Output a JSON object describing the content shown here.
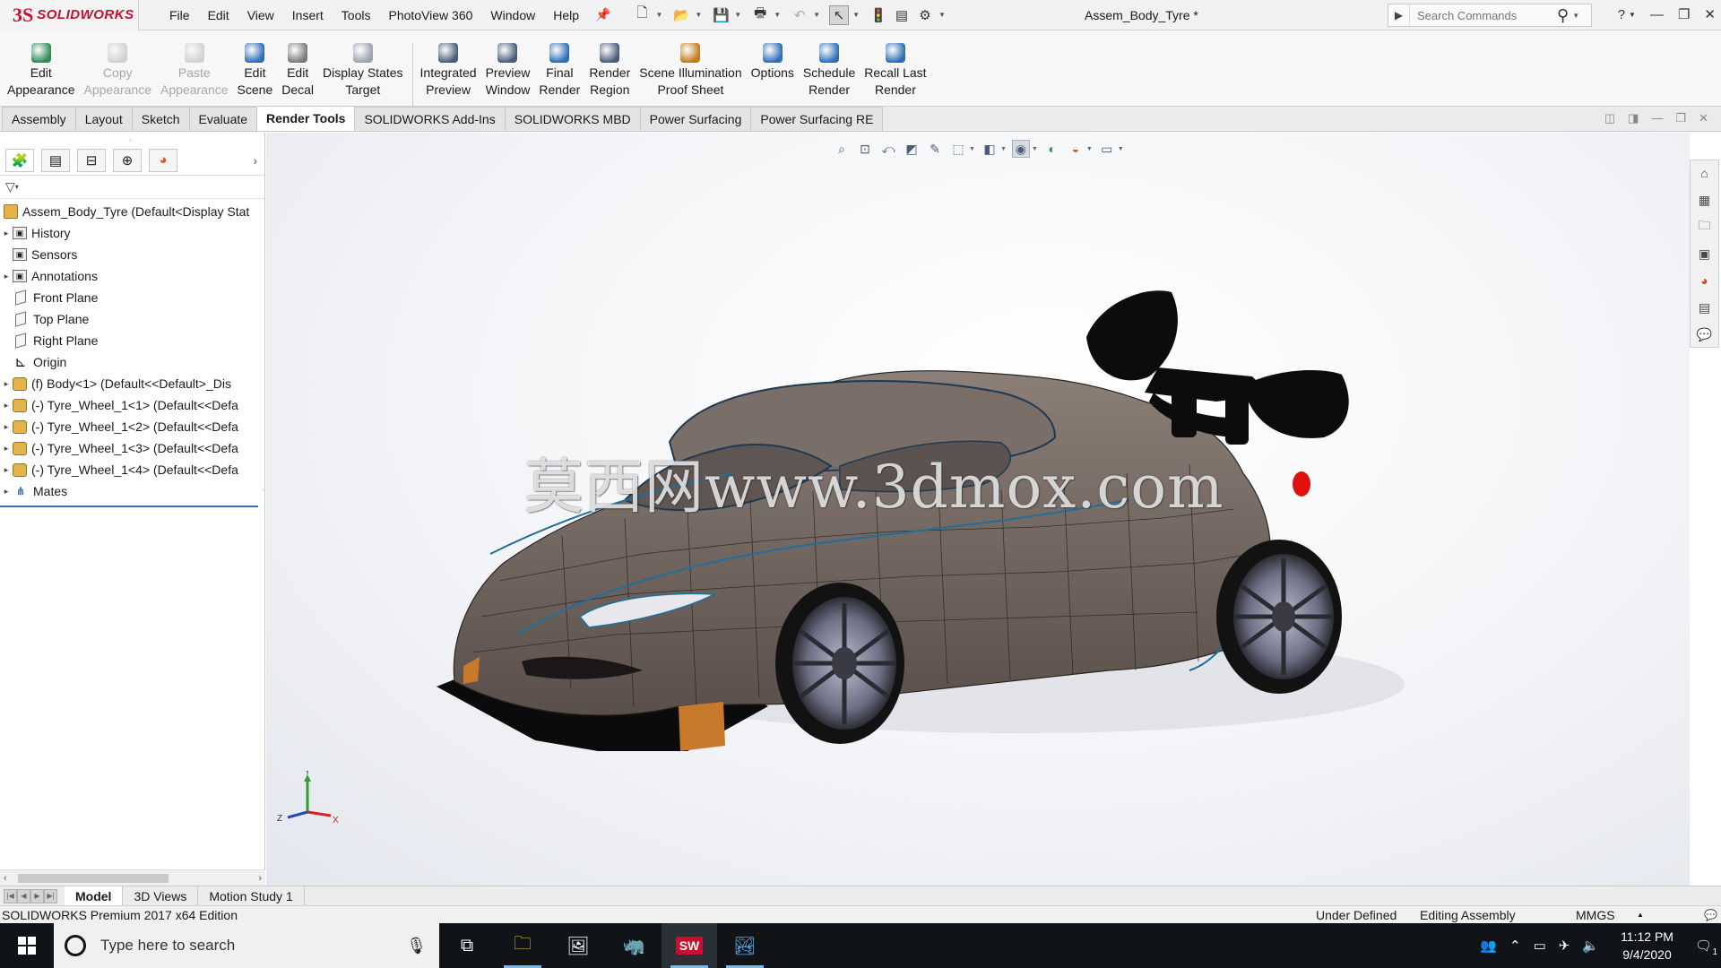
{
  "app": {
    "logo_ds": "3S",
    "logo_name": "SOLIDWORKS",
    "document_title": "Assem_Body_Tyre *"
  },
  "menu": [
    "File",
    "Edit",
    "View",
    "Insert",
    "Tools",
    "PhotoView 360",
    "Window",
    "Help"
  ],
  "search": {
    "placeholder": "Search Commands"
  },
  "command_manager": [
    {
      "line1": "Edit",
      "line2": "Appearance",
      "icon": "edit-appearance-icon",
      "color": "#2e8b57",
      "disabled": false
    },
    {
      "line1": "Copy",
      "line2": "Appearance",
      "icon": "copy-appearance-icon",
      "color": "#8a8a8a",
      "disabled": true
    },
    {
      "line1": "Paste",
      "line2": "Appearance",
      "icon": "paste-appearance-icon",
      "color": "#8a8a8a",
      "disabled": true
    },
    {
      "line1": "Edit",
      "line2": "Scene",
      "icon": "edit-scene-icon",
      "color": "#2f6db5",
      "disabled": false
    },
    {
      "line1": "Edit",
      "line2": "Decal",
      "icon": "edit-decal-icon",
      "color": "#7a7a7a",
      "disabled": false
    },
    {
      "line1": "Display States",
      "line2": "Target",
      "icon": "display-states-target-icon",
      "color": "#9aa3b0",
      "disabled": false
    },
    {
      "line1": "Integrated",
      "line2": "Preview",
      "icon": "integrated-preview-icon",
      "color": "#4a5d78",
      "disabled": false
    },
    {
      "line1": "Preview",
      "line2": "Window",
      "icon": "preview-window-icon",
      "color": "#4a5d78",
      "disabled": false
    },
    {
      "line1": "Final",
      "line2": "Render",
      "icon": "final-render-icon",
      "color": "#2f6db5",
      "disabled": false
    },
    {
      "line1": "Render",
      "line2": "Region",
      "icon": "render-region-icon",
      "color": "#4a5d78",
      "disabled": false
    },
    {
      "line1": "Scene Illumination",
      "line2": "Proof Sheet",
      "icon": "scene-illumination-icon",
      "color": "#c07a1c",
      "disabled": false
    },
    {
      "line1": "Options",
      "line2": "",
      "icon": "options-icon",
      "color": "#2f6db5",
      "disabled": false
    },
    {
      "line1": "Schedule",
      "line2": "Render",
      "icon": "schedule-render-icon",
      "color": "#2f6db5",
      "disabled": false
    },
    {
      "line1": "Recall Last",
      "line2": "Render",
      "icon": "recall-last-render-icon",
      "color": "#2f6db5",
      "disabled": false
    }
  ],
  "tabs": [
    {
      "label": "Assembly",
      "active": false
    },
    {
      "label": "Layout",
      "active": false
    },
    {
      "label": "Sketch",
      "active": false
    },
    {
      "label": "Evaluate",
      "active": false
    },
    {
      "label": "Render Tools",
      "active": true
    },
    {
      "label": "SOLIDWORKS Add-Ins",
      "active": false
    },
    {
      "label": "SOLIDWORKS MBD",
      "active": false
    },
    {
      "label": "Power Surfacing",
      "active": false
    },
    {
      "label": "Power Surfacing RE",
      "active": false
    }
  ],
  "feature_tree": {
    "root": "Assem_Body_Tyre  (Default<Display Stat",
    "items": [
      {
        "label": "History",
        "expandable": true,
        "icon": "folder"
      },
      {
        "label": "Sensors",
        "expandable": false,
        "icon": "folder"
      },
      {
        "label": "Annotations",
        "expandable": true,
        "icon": "folder"
      },
      {
        "label": "Front Plane",
        "expandable": false,
        "icon": "plane"
      },
      {
        "label": "Top Plane",
        "expandable": false,
        "icon": "plane"
      },
      {
        "label": "Right Plane",
        "expandable": false,
        "icon": "plane"
      },
      {
        "label": "Origin",
        "expandable": false,
        "icon": "origin"
      },
      {
        "label": "(f) Body<1> (Default<<Default>_Dis",
        "expandable": true,
        "icon": "part"
      },
      {
        "label": "(-) Tyre_Wheel_1<1> (Default<<Defa",
        "expandable": true,
        "icon": "part"
      },
      {
        "label": "(-) Tyre_Wheel_1<2> (Default<<Defa",
        "expandable": true,
        "icon": "part"
      },
      {
        "label": "(-) Tyre_Wheel_1<3> (Default<<Defa",
        "expandable": true,
        "icon": "part"
      },
      {
        "label": "(-) Tyre_Wheel_1<4> (Default<<Defa",
        "expandable": true,
        "icon": "part"
      },
      {
        "label": "Mates",
        "expandable": true,
        "icon": "mates"
      }
    ]
  },
  "viewport": {
    "watermark": "莫西网www.3dmox.com",
    "triad": {
      "x": "X",
      "y": "Y",
      "z": "Z"
    },
    "model_color": "#6e625c",
    "wing_color": "#111111",
    "taillight_color": "#e01010"
  },
  "bottom_tabs": [
    {
      "label": "Model",
      "active": true
    },
    {
      "label": "3D Views",
      "active": false
    },
    {
      "label": "Motion Study 1",
      "active": false
    }
  ],
  "status": {
    "edition": "SOLIDWORKS Premium 2017 x64 Edition",
    "definition": "Under Defined",
    "mode": "Editing Assembly",
    "units": "MMGS"
  },
  "taskbar": {
    "search_placeholder": "Type here to search",
    "time": "11:12 PM",
    "date": "9/4/2020",
    "notification_count": "1"
  }
}
